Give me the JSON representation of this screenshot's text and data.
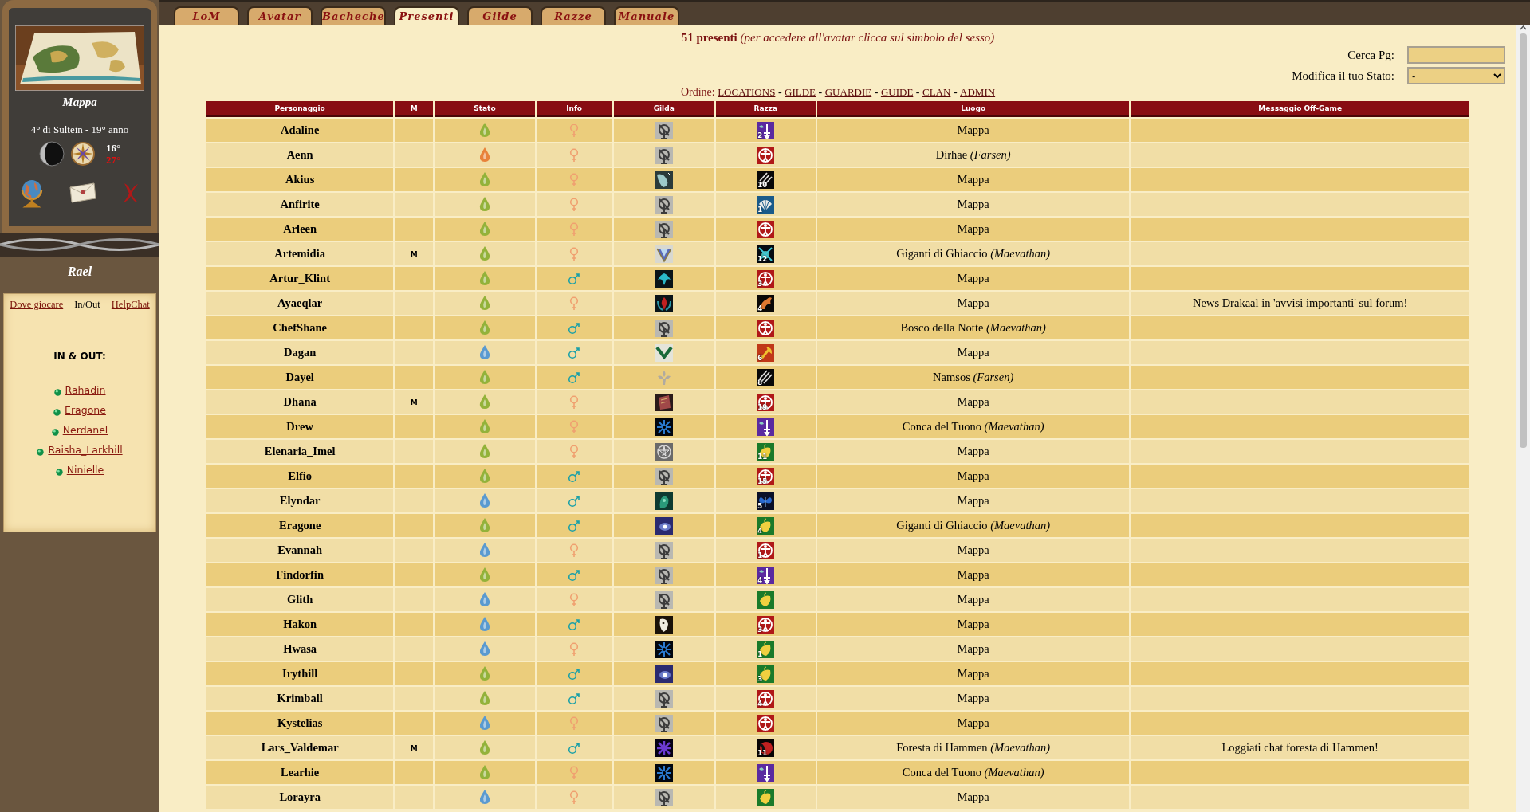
{
  "sidebar": {
    "location": "Mappa",
    "date": "4° di Sultein - 19° anno",
    "temperatures": [
      "16°",
      "27°"
    ],
    "character": "Rael",
    "links": [
      {
        "label": "Dove giocare",
        "selected": false
      },
      {
        "label": "In/Out",
        "selected": true
      },
      {
        "label": "HelpChat",
        "selected": false
      }
    ],
    "panel_title": "IN & OUT:",
    "online": [
      "Rahadin",
      "Eragone",
      "Nerdanel",
      "Raisha_Larkhill",
      "Ninielle"
    ]
  },
  "tabs": [
    {
      "label": "LoM",
      "selected": false
    },
    {
      "label": "Avatar",
      "selected": false
    },
    {
      "label": "Bacheche",
      "selected": false
    },
    {
      "label": "Presenti",
      "selected": true
    },
    {
      "label": "Gilde",
      "selected": false
    },
    {
      "label": "Razze",
      "selected": false
    },
    {
      "label": "Manuale",
      "selected": false
    }
  ],
  "summary": "**51 presenti** *(per accedere all'avatar clicca sul simbolo del sesso)*",
  "search": {
    "label": "Cerca Pg:"
  },
  "status_select": {
    "label": "Modifica il tuo Stato:",
    "value": "-"
  },
  "order": {
    "label": "Ordine:",
    "items": [
      {
        "kind": "link",
        "text": "LOCATIONS"
      },
      {
        "kind": "separator",
        "text": "-"
      },
      {
        "kind": "link",
        "text": "GILDE"
      },
      {
        "kind": "separator",
        "text": "-"
      },
      {
        "kind": "link",
        "text": "GUARDIE"
      },
      {
        "kind": "separator",
        "text": "-"
      },
      {
        "kind": "link",
        "text": "GUIDE"
      },
      {
        "kind": "separator",
        "text": "-"
      },
      {
        "kind": "link",
        "text": "CLAN"
      },
      {
        "kind": "separator",
        "text": "-"
      },
      {
        "kind": "link",
        "text": "ADMIN"
      }
    ]
  },
  "table": {
    "columns": [
      "Personaggio",
      "M",
      "Stato",
      "Info",
      "Gilda",
      "Razza",
      "Luogo",
      "Messaggio Off-Game"
    ],
    "rows": [
      {
        "name": "Adaline",
        "color": "#93b23a",
        "sex": {
          "kind": "female"
        },
        "guild": {
          "kind": "emblem"
        },
        "race": {
          "kind": "sword",
          "level": "2"
        },
        "location": "Mappa"
      },
      {
        "name": "Aenn",
        "color": "#e8823a",
        "sex": {
          "kind": "female"
        },
        "guild": {
          "kind": "emblem"
        },
        "race": {
          "kind": "figure"
        },
        "location": "Dirhae *(Farsen)*"
      },
      {
        "name": "Akius",
        "color": "#93b23a",
        "sex": {
          "kind": "female"
        },
        "guild": {
          "kind": "crystal"
        },
        "race": {
          "kind": "claws",
          "level": "10"
        },
        "location": "Mappa"
      },
      {
        "name": "Anfirite",
        "color": "#93b23a",
        "sex": {
          "kind": "female"
        },
        "guild": {
          "kind": "emblem"
        },
        "race": {
          "kind": "shell",
          "level": "1"
        },
        "location": "Mappa"
      },
      {
        "name": "Arleen",
        "color": "#93b23a",
        "sex": {
          "kind": "female"
        },
        "guild": {
          "kind": "emblem"
        },
        "race": {
          "kind": "figure"
        },
        "location": "Mappa"
      },
      {
        "name": "Artemidia",
        "master": "M",
        "color": "#93b23a",
        "sex": {
          "kind": "female"
        },
        "guild": {
          "kind": "diamond"
        },
        "race": {
          "kind": "swords",
          "level": "12"
        },
        "location": "Giganti di Ghiaccio *(Maevathan)*"
      },
      {
        "name": "Artur_Klint",
        "color": "#93b23a",
        "sex": {
          "kind": "male"
        },
        "guild": {
          "kind": "phoenix"
        },
        "race": {
          "kind": "figure",
          "level": "3"
        },
        "location": "Mappa"
      },
      {
        "name": "Ayaeqlar",
        "color": "#93b23a",
        "sex": {
          "kind": "female"
        },
        "guild": {
          "kind": "phoenix-red"
        },
        "race": {
          "kind": "dragon",
          "level": "4"
        },
        "location": "Mappa",
        "message": "News Drakaal in 'avvisi importanti' sul forum!"
      },
      {
        "name": "ChefShane",
        "color": "#93b23a",
        "sex": {
          "kind": "male"
        },
        "guild": {
          "kind": "emblem"
        },
        "race": {
          "kind": "figure"
        },
        "location": "Bosco della Notte *(Maevathan)*"
      },
      {
        "name": "Dagan",
        "color": "#5a9ad0",
        "sex": {
          "kind": "male"
        },
        "guild": {
          "kind": "chevron"
        },
        "race": {
          "kind": "axe",
          "level": "6"
        },
        "location": "Mappa"
      },
      {
        "name": "Dayel",
        "color": "#93b23a",
        "sex": {
          "kind": "male"
        },
        "guild": {
          "kind": "fleur"
        },
        "race": {
          "kind": "claws",
          "level": "8"
        },
        "location": "Namsos *(Farsen)*"
      },
      {
        "name": "Dhana",
        "master": "M",
        "color": "#93b23a",
        "sex": {
          "kind": "female"
        },
        "guild": {
          "kind": "book"
        },
        "race": {
          "kind": "figure",
          "level": "19"
        },
        "location": "Mappa"
      },
      {
        "name": "Drew",
        "color": "#93b23a",
        "sex": {
          "kind": "female"
        },
        "guild": {
          "kind": "snowflake"
        },
        "race": {
          "kind": "sword"
        },
        "location": "Conca del Tuono *(Maevathan)*"
      },
      {
        "name": "Elenaria_Imel",
        "color": "#93b23a",
        "sex": {
          "kind": "female"
        },
        "guild": {
          "kind": "pentagram"
        },
        "race": {
          "kind": "leaf",
          "level": "11"
        },
        "location": "Mappa"
      },
      {
        "name": "Elfio",
        "color": "#93b23a",
        "sex": {
          "kind": "male"
        },
        "guild": {
          "kind": "emblem"
        },
        "race": {
          "kind": "figure",
          "level": "15"
        },
        "location": "Mappa"
      },
      {
        "name": "Elyndar",
        "color": "#5a9ad0",
        "sex": {
          "kind": "male"
        },
        "guild": {
          "kind": "spirit"
        },
        "race": {
          "kind": "butterfly",
          "level": "5"
        },
        "location": "Mappa"
      },
      {
        "name": "Eragone",
        "color": "#93b23a",
        "sex": {
          "kind": "male"
        },
        "guild": {
          "kind": "nebula"
        },
        "race": {
          "kind": "leaf",
          "level": "4"
        },
        "location": "Giganti di Ghiaccio *(Maevathan)*"
      },
      {
        "name": "Evannah",
        "color": "#5a9ad0",
        "sex": {
          "kind": "female"
        },
        "guild": {
          "kind": "emblem"
        },
        "race": {
          "kind": "figure",
          "level": "1"
        },
        "location": "Mappa"
      },
      {
        "name": "Findorfin",
        "color": "#93b23a",
        "sex": {
          "kind": "male"
        },
        "guild": {
          "kind": "emblem"
        },
        "race": {
          "kind": "sword",
          "level": "4"
        },
        "location": "Mappa"
      },
      {
        "name": "Glith",
        "color": "#5a9ad0",
        "sex": {
          "kind": "female"
        },
        "guild": {
          "kind": "emblem"
        },
        "race": {
          "kind": "leaf"
        },
        "location": "Mappa"
      },
      {
        "name": "Hakon",
        "color": "#5a9ad0",
        "sex": {
          "kind": "male"
        },
        "guild": {
          "kind": "mask"
        },
        "race": {
          "kind": "figure",
          "level": "3"
        },
        "location": "Mappa"
      },
      {
        "name": "Hwasa",
        "color": "#5a9ad0",
        "sex": {
          "kind": "female"
        },
        "guild": {
          "kind": "snowflake"
        },
        "race": {
          "kind": "leaf",
          "level": "1"
        },
        "location": "Mappa"
      },
      {
        "name": "Irythill",
        "color": "#93b23a",
        "sex": {
          "kind": "male"
        },
        "guild": {
          "kind": "nebula"
        },
        "race": {
          "kind": "leaf",
          "level": "3"
        },
        "location": "Mappa"
      },
      {
        "name": "Krimball",
        "color": "#93b23a",
        "sex": {
          "kind": "male"
        },
        "guild": {
          "kind": "emblem"
        },
        "race": {
          "kind": "figure",
          "level": "4"
        },
        "location": "Mappa"
      },
      {
        "name": "Kystelias",
        "color": "#5a9ad0",
        "sex": {
          "kind": "female"
        },
        "guild": {
          "kind": "emblem"
        },
        "race": {
          "kind": "figure"
        },
        "location": "Mappa"
      },
      {
        "name": "Lars_Valdemar",
        "master": "M",
        "color": "#93b23a",
        "sex": {
          "kind": "male"
        },
        "guild": {
          "kind": "snowflake-violet"
        },
        "race": {
          "kind": "moon",
          "level": "11"
        },
        "location": "Foresta di Hammen *(Maevathan)*",
        "message": "Loggiati chat foresta di Hammen!"
      },
      {
        "name": "Learhie",
        "color": "#93b23a",
        "sex": {
          "kind": "female"
        },
        "guild": {
          "kind": "snowflake"
        },
        "race": {
          "kind": "sword"
        },
        "location": "Conca del Tuono *(Maevathan)*"
      },
      {
        "name": "Lorayra",
        "color": "#5a9ad0",
        "sex": {
          "kind": "female"
        },
        "guild": {
          "kind": "emblem"
        },
        "race": {
          "kind": "leaf"
        },
        "location": "Mappa"
      }
    ]
  }
}
